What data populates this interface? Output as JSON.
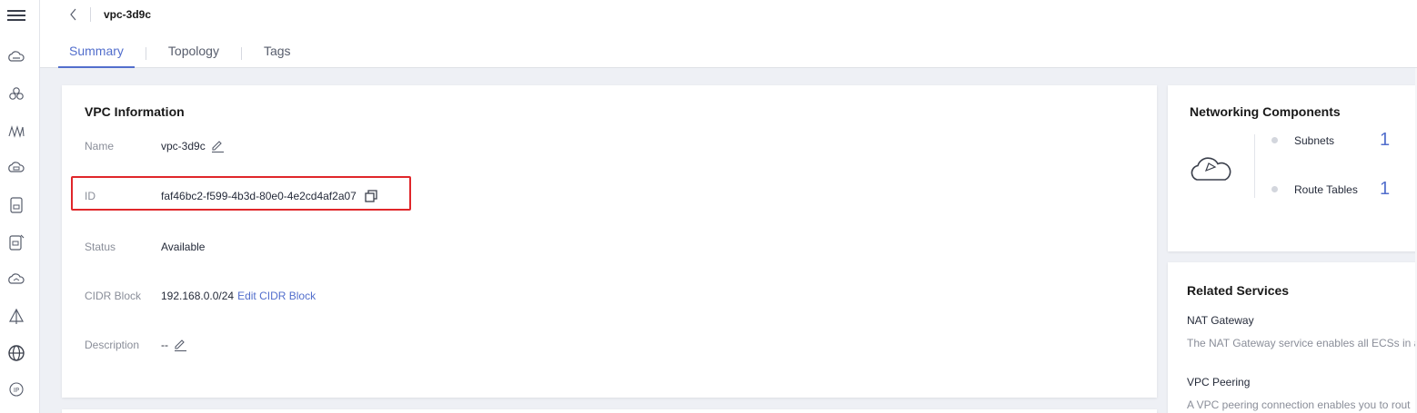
{
  "header": {
    "title": "vpc-3d9c",
    "tabs": [
      {
        "label": "Summary",
        "active": true
      },
      {
        "label": "Topology",
        "active": false
      },
      {
        "label": "Tags",
        "active": false
      }
    ]
  },
  "sidebar": {
    "icons": [
      "menu-icon",
      "cloud-icon",
      "cluster-icon",
      "network-icon",
      "cloud-storage-icon",
      "document-icon",
      "document-edit-icon",
      "cloud-connect-icon",
      "tent-icon",
      "globe-icon",
      "ip-icon"
    ]
  },
  "vpc_info": {
    "title": "VPC Information",
    "name_label": "Name",
    "name_value": "vpc-3d9c",
    "id_label": "ID",
    "id_value": "faf46bc2-f599-4b3d-80e0-4e2cd4af2a07",
    "status_label": "Status",
    "status_value": "Available",
    "cidr_label": "CIDR Block",
    "cidr_value": "192.168.0.0/24",
    "cidr_edit_link": "Edit CIDR Block",
    "description_label": "Description",
    "description_value": "--"
  },
  "networking": {
    "title": "Networking Components",
    "items": [
      {
        "label": "Subnets",
        "count": "1"
      },
      {
        "label": "Route Tables",
        "count": "1"
      }
    ]
  },
  "related": {
    "title": "Related Services",
    "services": [
      {
        "name": "NAT Gateway",
        "desc": "The NAT Gateway service enables all ECSs in a"
      },
      {
        "name": "VPC Peering",
        "desc": "A VPC peering connection enables you to rout"
      }
    ]
  },
  "colors": {
    "accent": "#526ecc",
    "highlight_border": "#e0262a",
    "label_gray": "#8a8e99",
    "page_bg": "#eef0f5"
  }
}
